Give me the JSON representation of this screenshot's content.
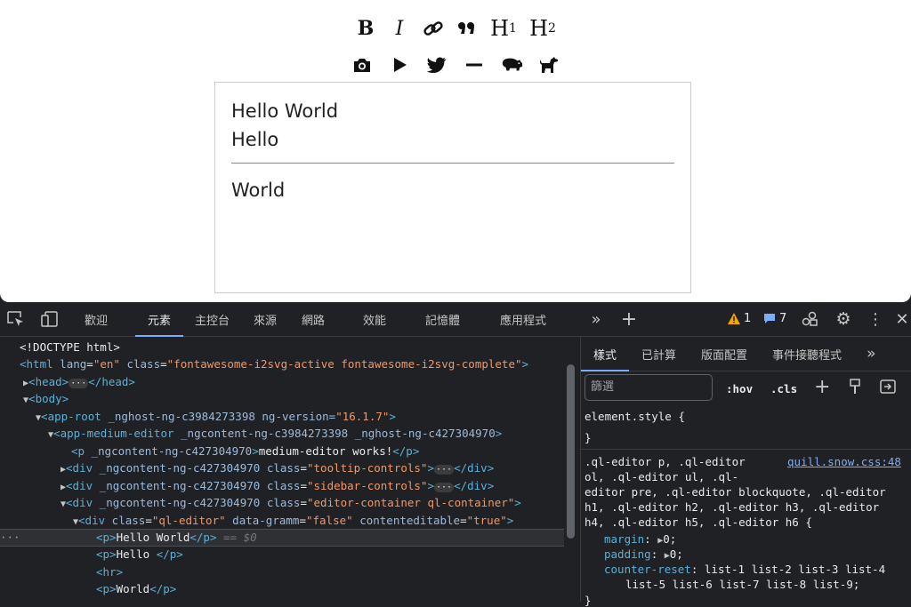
{
  "toolbar": {
    "bold": "B",
    "italic": "I",
    "h1": "H",
    "h1_sub": "1",
    "h2": "H",
    "h2_sub": "2"
  },
  "editor": {
    "lines": [
      "Hello World",
      "Hello",
      "World"
    ]
  },
  "devtools": {
    "tabs": [
      "歡迎",
      "元素",
      "主控台",
      "來源",
      "網路",
      "效能",
      "記憶體",
      "應用程式"
    ],
    "active_tab": "元素",
    "warnings": "1",
    "messages": "7",
    "dom": {
      "doctype": "<!DOCTYPE html>",
      "html_tag": "html",
      "html_lang": "en",
      "html_class": "fontawesome-i2svg-active fontawesome-i2svg-complete",
      "head": "head",
      "body": "body",
      "app_root": "app-root",
      "app_root_attrs": "_nghost-ng-c3984273398 ng-version=",
      "app_root_version": "\"16.1.7\"",
      "app_medium": "app-medium-editor",
      "app_medium_attrs": "_ngcontent-ng-c3984273398 _nghost-ng-c427304970",
      "p_tag_attr": "_ngcontent-ng-c427304970",
      "p_text": "medium-editor works!",
      "div_attr": "_ngcontent-ng-c427304970",
      "tooltip_class": "\"tooltip-controls\"",
      "sidebar_class": "\"sidebar-controls\"",
      "container_class": "\"editor-container ql-container\"",
      "ql_class": "\"ql-editor\"",
      "ql_gramm": "\"false\"",
      "ql_ce": "\"true\"",
      "p1": "Hello World",
      "eq": "== $0",
      "p2": "Hello ",
      "hr": "hr",
      "p3": "World"
    },
    "styles": {
      "tabs": [
        "樣式",
        "已計算",
        "版面配置",
        "事件接聽程式"
      ],
      "filter_placeholder": "篩選",
      "hov": ":hov",
      "cls": ".cls",
      "element_style": "element.style {",
      "close_brace": "}",
      "selector_1": ".ql-editor p, .ql-editor",
      "selector_2": "ol, .ql-editor ul, .ql-",
      "selector_3": "editor pre, .ql-editor blockquote, .ql-editor",
      "selector_4": "h1, .ql-editor h2, .ql-editor h3, .ql-editor",
      "selector_5": "h4, .ql-editor h5, .ql-editor h6 {",
      "source": "quill.snow.css:48",
      "margin_name": "margin",
      "margin_val": "0;",
      "padding_name": "padding",
      "padding_val": "0;",
      "counter_name": "counter-reset",
      "counter_val1": "list-1 list-2 list-3 list-4",
      "counter_val2": "list-5 list-6 list-7 list-8 list-9;"
    }
  }
}
